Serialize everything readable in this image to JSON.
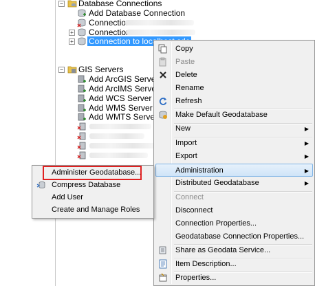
{
  "tree": {
    "database_connections": "Database Connections",
    "add_database_connection": "Add Database Connection",
    "connection_1": "Connection",
    "connection_2": "Connection",
    "connection_selected": "Connection to localhost.sde",
    "gis_servers": "GIS Servers",
    "add_arcgis_server": "Add ArcGIS Server",
    "add_arcims_server": "Add ArcIMS Server",
    "add_wcs_server": "Add WCS Server",
    "add_wms_server": "Add WMS Server",
    "add_wmts_server": "Add WMTS Server"
  },
  "context_menu": {
    "copy": "Copy",
    "paste": "Paste",
    "delete": "Delete",
    "rename": "Rename",
    "refresh": "Refresh",
    "make_default": "Make Default Geodatabase",
    "new": "New",
    "import": "Import",
    "export": "Export",
    "administration": "Administration",
    "distributed": "Distributed Geodatabase",
    "connect": "Connect",
    "disconnect": "Disconnect",
    "connection_properties": "Connection Properties...",
    "gdb_connection_properties": "Geodatabase Connection Properties...",
    "share_as_service": "Share as Geodata Service...",
    "item_description": "Item Description...",
    "properties": "Properties..."
  },
  "submenu": {
    "administer": "Administer Geodatabase...",
    "compress": "Compress Database",
    "add_user": "Add User",
    "create_roles": "Create and Manage Roles"
  },
  "colors": {
    "selection": "#3399ff",
    "menu_bg": "#f0f0f0",
    "highlight_border": "#7fb4e6",
    "annotation_red": "#e02020",
    "folder_yellow": "#e8c24a",
    "server_gray": "#8a8f96"
  }
}
